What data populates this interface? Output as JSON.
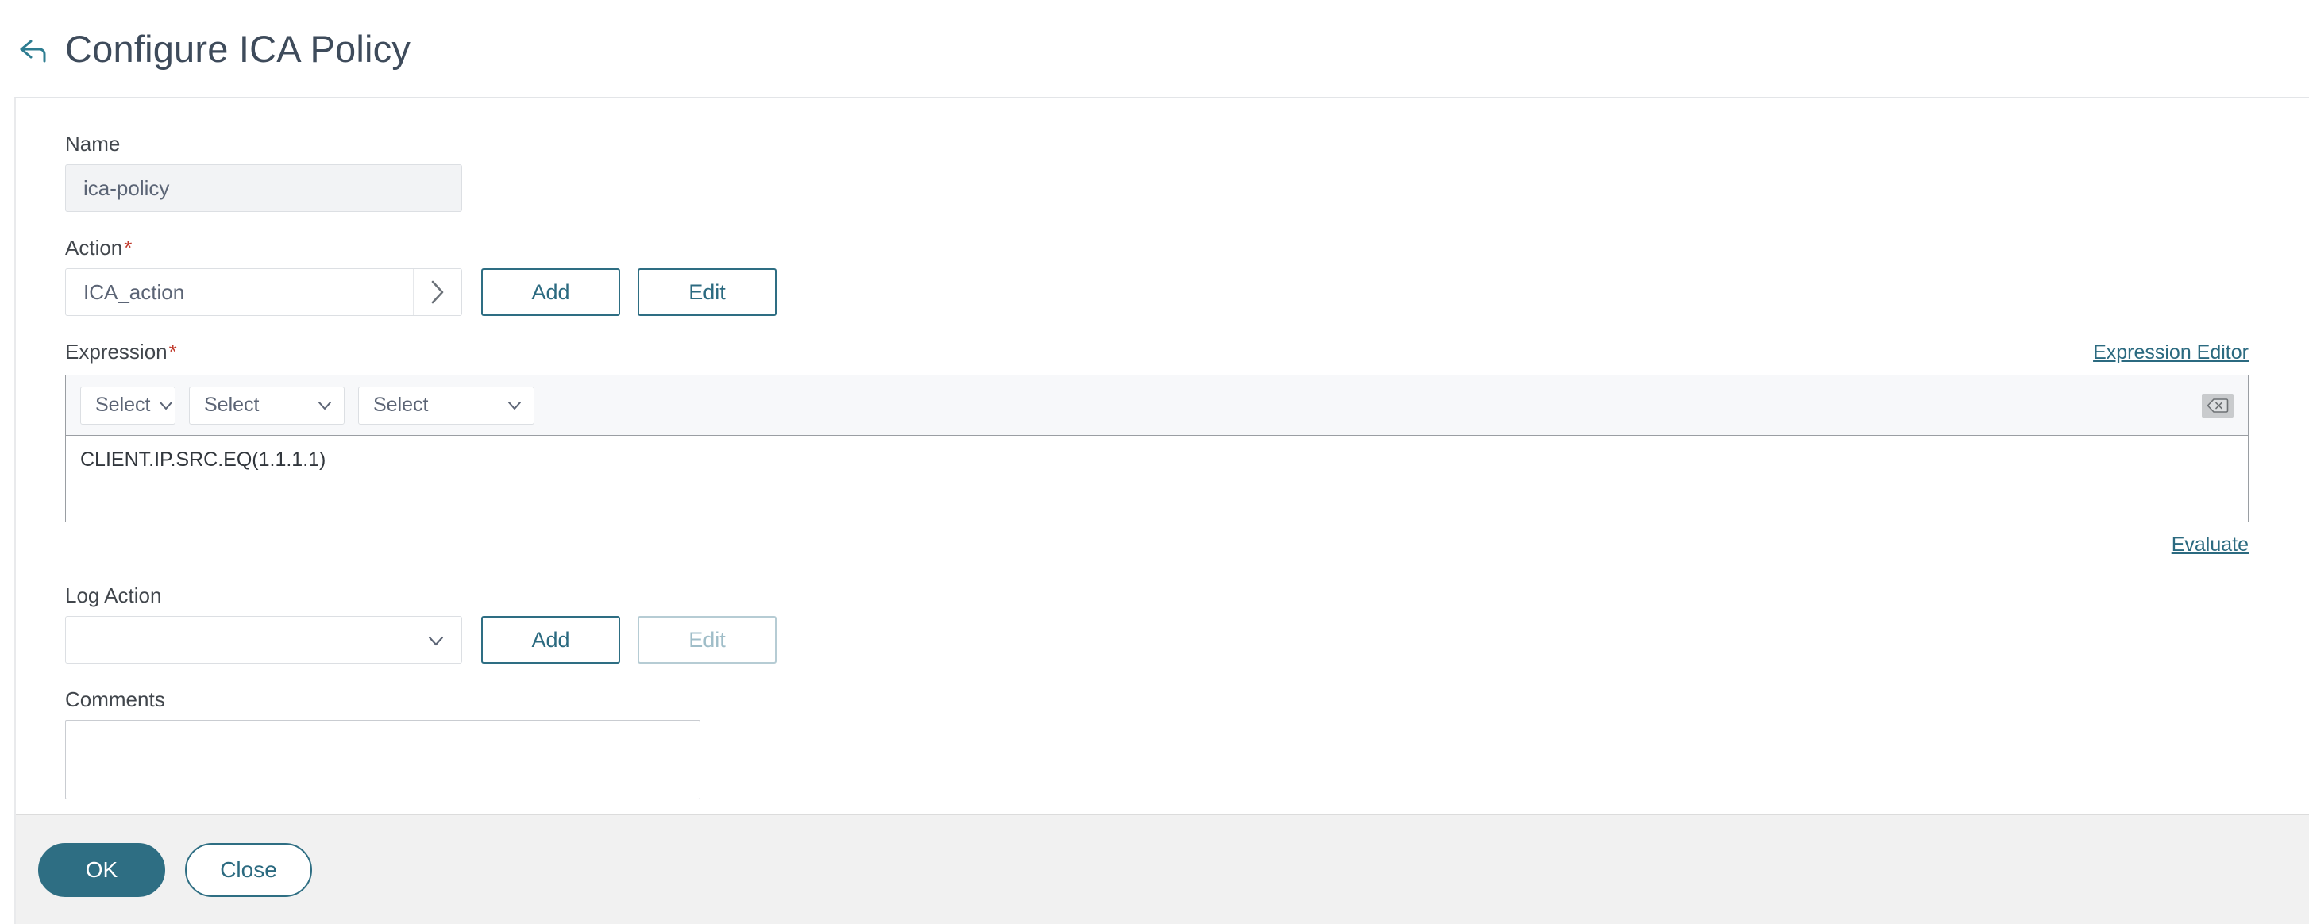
{
  "header": {
    "back_icon": "back-arrow-icon",
    "title": "Configure ICA Policy"
  },
  "form": {
    "name": {
      "label": "Name",
      "value": "ica-policy",
      "placeholder": ""
    },
    "action": {
      "label": "Action",
      "required_marker": "*",
      "value": "ICA_action",
      "placeholder": "",
      "expand_icon": "chevron-right-icon",
      "add_label": "Add",
      "edit_label": "Edit"
    },
    "expression": {
      "label": "Expression",
      "required_marker": "*",
      "editor_link": "Expression Editor",
      "selects": [
        {
          "value": "Select",
          "icon": "chevron-down-icon"
        },
        {
          "value": "Select",
          "icon": "chevron-down-icon"
        },
        {
          "value": "Select",
          "icon": "chevron-down-icon"
        }
      ],
      "backspace_icon": "backspace-delete-icon",
      "value": "CLIENT.IP.SRC.EQ(1.1.1.1)",
      "evaluate_link": "Evaluate"
    },
    "log_action": {
      "label": "Log Action",
      "value": "",
      "dropdown_icon": "chevron-down-icon",
      "add_label": "Add",
      "edit_label": "Edit",
      "edit_disabled": true
    },
    "comments": {
      "label": "Comments",
      "value": "",
      "placeholder": ""
    }
  },
  "footer": {
    "ok_label": "OK",
    "close_label": "Close"
  },
  "colors": {
    "accent_teal": "#2e6e83",
    "title_slate": "#3e4b5b",
    "required_red": "#c0392b",
    "disabled_teal": "#9fbdc8",
    "footer_bg": "#f1f1f1",
    "readonly_bg": "#f2f3f5"
  }
}
